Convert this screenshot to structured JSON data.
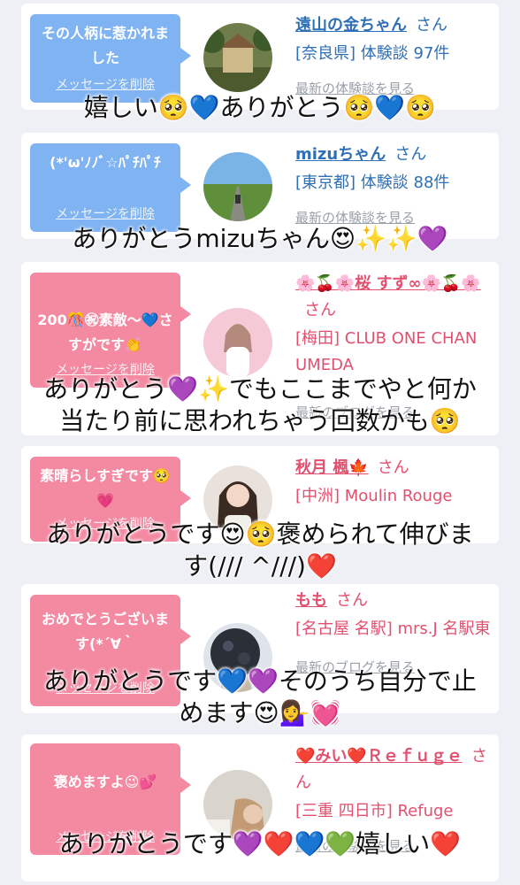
{
  "delete_label": "メッセージを削除",
  "latest_experience_label": "最新の体験談を見る",
  "latest_blog_label": "最新のブログを見る",
  "cards": [
    {
      "message": "その人柄に惹かれました",
      "name": "遠山の金ちゃん",
      "honorific": "さん",
      "meta": "[奈良県] 体験談 97件",
      "caption": "嬉しい🥺💙ありがとう🥺💙🥺"
    },
    {
      "message": "(*'ω'ﾉﾉﾞ☆ﾊﾟﾁﾊﾟﾁ",
      "name": "mizuちゃん",
      "honorific": "さん",
      "meta": "[東京都] 体験談 88件",
      "caption": "ありがとうmizuちゃん😍✨✨💜"
    },
    {
      "message": "200🎊㊗素敵〜💙さすがです👏",
      "name": "🌸🍒🌸桜 すず∞🌸🍒🌸",
      "honorific": "さん",
      "meta": "[梅田] CLUB ONE CHAN UMEDA",
      "caption_line1": "ありがとう💜✨でもここまでやと何か",
      "caption_line2": "当たり前に思われちゃう回数かも🥺"
    },
    {
      "message": "素晴らしすぎです🥺💗",
      "name": "秋月 楓🍁",
      "honorific": "さん",
      "meta": "[中洲] Moulin Rouge",
      "caption_line1": "ありがとうです😍🥺褒められて伸びま",
      "caption_line2": "す(/// ^///)❤️"
    },
    {
      "message": "おめでとうございます(*´∀｀",
      "name": "もも",
      "honorific": "さん",
      "meta": "[名古屋 名駅] mrs.J 名駅東",
      "caption_line1": "ありがとうです💙💜そのうち自分で止",
      "caption_line2": "めます😍💁‍♀️💓"
    },
    {
      "message": "褒めますよ😉💕",
      "name": "❤️みい❤️Ｒｅｆｕｇｅ",
      "honorific": "さん",
      "meta": "[三重 四日市] Refuge",
      "caption": "ありがとうです💜❤️💙💚嬉しい❤️"
    }
  ]
}
